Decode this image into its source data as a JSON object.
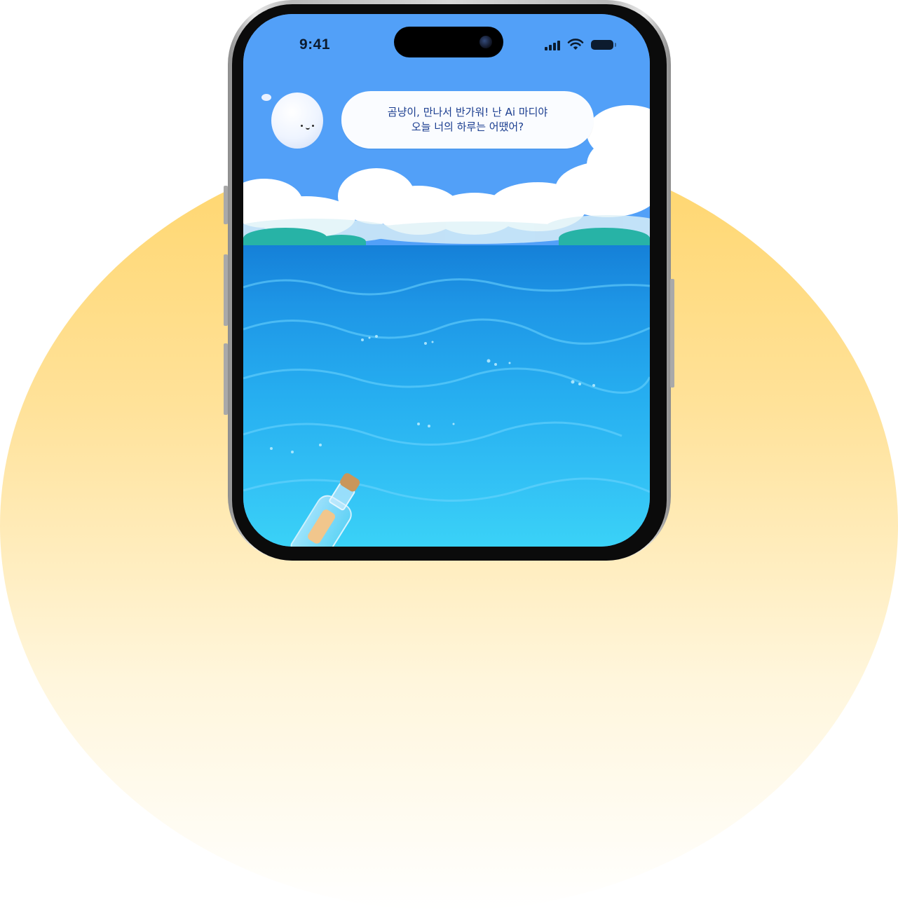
{
  "status_bar": {
    "time": "9:41",
    "icons": [
      "cellular-signal-icon",
      "wifi-icon",
      "battery-icon"
    ]
  },
  "mascot": {
    "icon": "cloud-mascot-icon"
  },
  "speech_bubble": {
    "line1": "곰냥이, 만나서 반가워! 난 Ai 마디야",
    "line2": "오늘 너의 하루는 어땠어?"
  },
  "scene": {
    "background_icons": [
      "clouds-icon",
      "islands-icon",
      "ocean-icon",
      "message-bottle-icon"
    ]
  },
  "colors": {
    "sky": "#52a0f8",
    "sea": "#26aef0",
    "sun_glow": "#ffd56a",
    "speech_text": "#1a3d8f"
  }
}
